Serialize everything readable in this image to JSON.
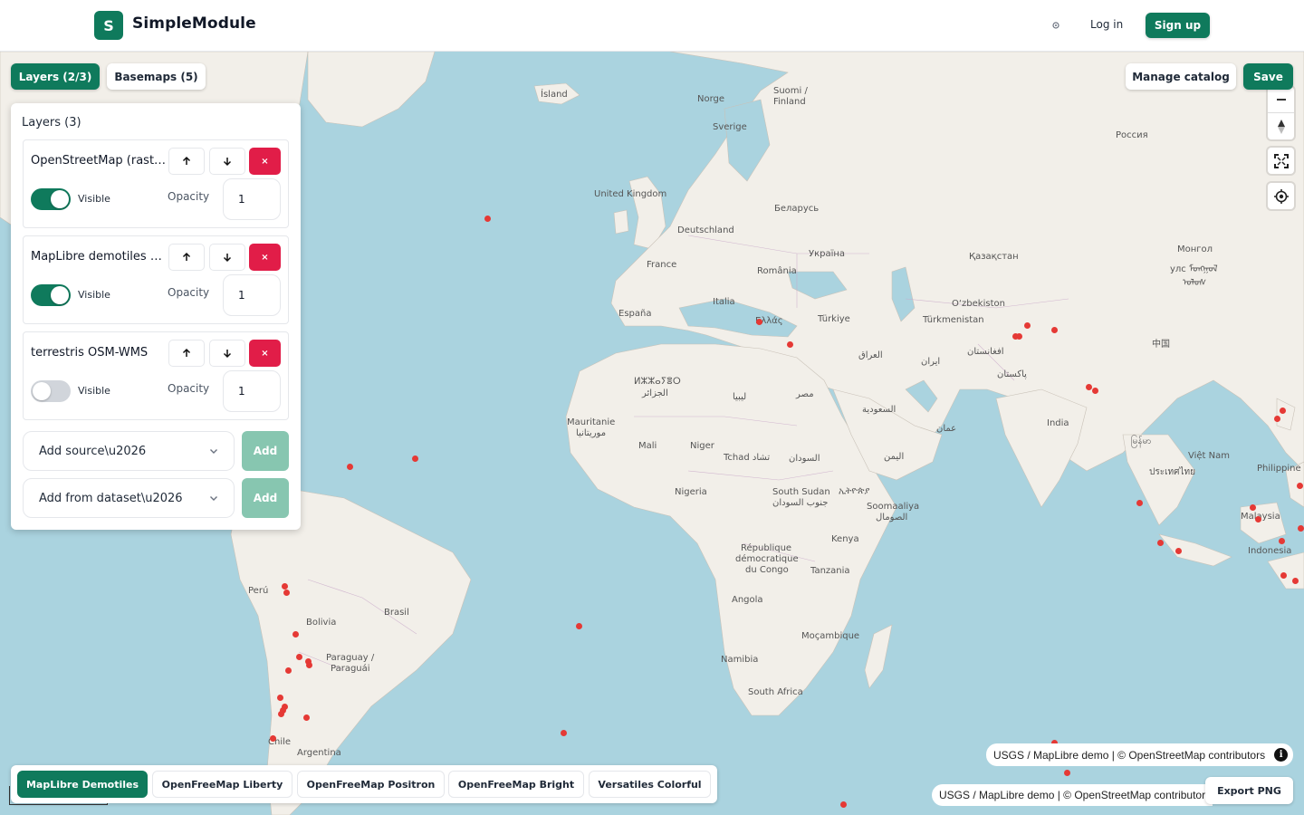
{
  "header": {
    "logo_letter": "S",
    "brand": "SimpleModule",
    "login": "Log in",
    "signup": "Sign up"
  },
  "toolbar": {
    "layers_tab": "Layers (2/3)",
    "basemaps_tab": "Basemaps (5)",
    "manage_catalog": "Manage catalog",
    "save": "Save"
  },
  "layers_panel": {
    "title": "Layers (3)",
    "visible_label": "Visible",
    "opacity_label": "Opacity",
    "delete_glyph": "×",
    "layers": [
      {
        "name": "OpenStreetMap (raster)",
        "visible": true,
        "opacity": "1"
      },
      {
        "name": "MapLibre demotiles polygons",
        "visible": true,
        "opacity": "1"
      },
      {
        "name": "terrestris OSM-WMS",
        "visible": false,
        "opacity": "1"
      }
    ],
    "add_source_placeholder": "Add source\\u2026",
    "add_dataset_placeholder": "Add from dataset\\u2026",
    "add_label": "Add"
  },
  "basemaps": [
    {
      "label": "MapLibre Demotiles",
      "active": true
    },
    {
      "label": "OpenFreeMap Liberty",
      "active": false
    },
    {
      "label": "OpenFreeMap Positron",
      "active": false
    },
    {
      "label": "OpenFreeMap Bright",
      "active": false
    },
    {
      "label": "Versatiles Colorful",
      "active": false
    }
  ],
  "attribution": {
    "primary": "USGS / MapLibre demo | © OpenStreetMap contributors",
    "secondary": "USGS / MapLibre demo | © OpenStreetMap contributors",
    "info_glyph": "i"
  },
  "export_png": "Export PNG",
  "map_labels": {
    "island": "Ísland",
    "norge": "Norge",
    "suomi": "Suomi /",
    "finland": "Finland",
    "sverige": "Sverige",
    "rossiya": "Россия",
    "uk": "United Kingdom",
    "belarus": "Беларусь",
    "deutschland": "Deutschland",
    "ukraine": "Україна",
    "kazakhstan": "Қазақстан",
    "mongol1": "Монгол",
    "mongol2": "улс ᠮᠤᠩᠭᠤᠯ",
    "mongol3": "ᠤᠯᠤᠰ",
    "france": "France",
    "romania": "România",
    "italia": "Italia",
    "uzbek": "O‘zbekiston",
    "espana": "España",
    "ellada": "Ελλάς",
    "turkiye": "Türkiye",
    "turkmen": "Türkmenistan",
    "zhongguo": "中国",
    "iraq": "العراق",
    "iran": "ایران",
    "afghan": "افغانستان",
    "pakistan": "پاکستان",
    "algeria1": "ⵍⵣⵣⴰⵢⴻⵔ",
    "algeria2": "الجزائر",
    "libya": "ليبيا",
    "egypt": "مصر",
    "saudi": "السعودية",
    "india": "India",
    "oman": "عمان",
    "myanmar": "မြန်မာ",
    "mauritanie": "Mauritanie",
    "mauritania_ar": "موريتانيا",
    "mali": "Mali",
    "niger": "Niger",
    "tchad": "Tchad تشاد",
    "sudan": "السودان",
    "yemen": "اليمن",
    "vietnam": "Việt Nam",
    "thailand": "ประเทศไทย",
    "philippines": "Philippine",
    "nigeria": "Nigeria",
    "south_sudan1": "South Sudan",
    "south_sudan2": "جنوب السودان",
    "ethiopia": "ኢትዮጵያ",
    "somalia1": "Soomaaliya",
    "somalia2": "الصومال",
    "malaysia": "Malaysia",
    "indonesia": "Indonesia",
    "rdc1": "République",
    "rdc2": "démocratique",
    "rdc3": "du Congo",
    "kenya": "Kenya",
    "tanzania": "Tanzania",
    "peru": "Perú",
    "brasil": "Brasil",
    "bolivia": "Bolivia",
    "angola": "Angola",
    "paraguay1": "Paraguay /",
    "paraguay2": "Paraguái",
    "mozambique": "Moçambique",
    "namibia": "Namibia",
    "south_africa": "South Africa",
    "chile": "Chile",
    "argentina": "Argentina"
  },
  "icons": {
    "theme": "sun-icon",
    "arrow_up": "arrow-up-icon",
    "arrow_down": "arrow-down-icon",
    "chevron": "chevron-down-icon",
    "zoom_out": "minus-icon",
    "compass": "compass-icon",
    "fullscreen": "fullscreen-icon",
    "geolocate": "geolocate-icon"
  },
  "colors": {
    "brand_green": "#0f7a5c",
    "danger": "#e11d48",
    "water": "#aad3df",
    "land": "#f2efe9",
    "marker": "#e53935"
  }
}
